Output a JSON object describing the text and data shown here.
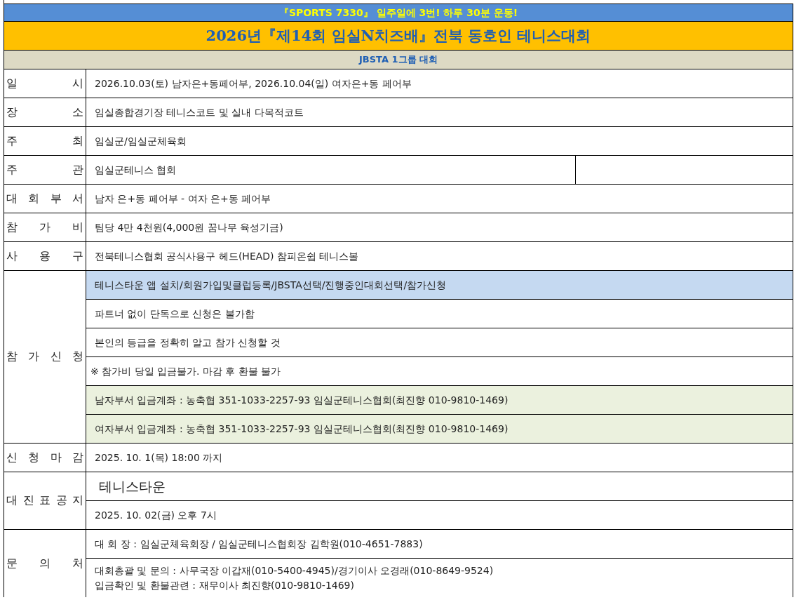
{
  "banner": "『SPORTS 7330』 일주일에 3번! 하루 30분 운동!",
  "title": "2026년『제14회 임실N치즈배』전북 동호인 테니스대회",
  "subtitle": "JBSTA 1그룹 대회",
  "rows": [
    {
      "label": "일 시",
      "split": false,
      "values": [
        {
          "kind": "text",
          "lines": [
            "2026.10.03(토) 남자은+동페어부, 2026.10.04(일) 여자은+동 페어부"
          ]
        }
      ]
    },
    {
      "label": "장 소",
      "split": false,
      "values": [
        {
          "kind": "text",
          "lines": [
            "임실종합경기장 테니스코트 및 실내 다목적코트"
          ]
        }
      ]
    },
    {
      "label": "주 최",
      "split": false,
      "values": [
        {
          "kind": "text",
          "lines": [
            "임실군/임실군체육회"
          ]
        }
      ]
    },
    {
      "label": "주 관",
      "split": true,
      "values": [
        {
          "kind": "text",
          "lines": [
            "임실군테니스 협회"
          ]
        }
      ]
    },
    {
      "label": "대 회 부 서",
      "split": false,
      "values": [
        {
          "kind": "text",
          "lines": [
            "남자 은+동 페어부 - 여자 은+동 페어부"
          ]
        }
      ]
    },
    {
      "label": "참 가 비",
      "split": false,
      "values": [
        {
          "kind": "text",
          "lines": [
            "팀당 4만 4천원(4,000원 꿈나무 육성기금)"
          ]
        }
      ]
    },
    {
      "label": "사 용 구",
      "split": false,
      "values": [
        {
          "kind": "text",
          "lines": [
            "전북테니스협회 공식사용구 헤드(HEAD) 참피온쉽 테니스볼"
          ]
        }
      ]
    },
    {
      "label": "참 가 신 청",
      "split": false,
      "values": [
        {
          "kind": "text",
          "color": "#c5d9f1",
          "lines": [
            "테니스타운 앱 설치/회원가입및클럽등록/JBSTA선택/진행중인대회선택/참가신청"
          ]
        },
        {
          "kind": "text",
          "lines": [
            "파트너 없이 단독으로 신청은 불가함"
          ]
        },
        {
          "kind": "text",
          "lines": [
            "본인의 등급을 정확히 알고 참가 신청할 것"
          ]
        },
        {
          "kind": "note",
          "lines": [
            "※ 참가비 당일 입금불가. 마감 후 환불 불가"
          ]
        },
        {
          "kind": "text",
          "color": "#ebf1de",
          "lines": [
            "남자부서 입금계좌 : 농축협 351-1033-2257-93 임실군테니스협회(최진향 010-9810-1469)"
          ]
        },
        {
          "kind": "text",
          "color": "#ebf1de",
          "lines": [
            "여자부서 입금계좌 : 농축협 351-1033-2257-93 임실군테니스협회(최진향 010-9810-1469)"
          ]
        }
      ]
    },
    {
      "label": "신 청 마 감",
      "split": false,
      "values": [
        {
          "kind": "text",
          "lines": [
            "2025. 10. 1(목) 18:00 까지"
          ]
        }
      ]
    },
    {
      "label": "대 진 표 공 지",
      "split": false,
      "values": [
        {
          "kind": "heading",
          "lines": [
            "테니스타운"
          ]
        },
        {
          "kind": "text",
          "lines": [
            "2025. 10. 02(금) 오후 7시"
          ]
        }
      ]
    },
    {
      "label": "문 의 처",
      "split": false,
      "values": [
        {
          "kind": "text",
          "lines": [
            "대 회 장 : 임실군체육회장 / 임실군테니스협회장 김학원(010-4651-7883)"
          ]
        },
        {
          "kind": "text",
          "lines": [
            "대회총괄 및 문의 : 사무국장 이갑재(010-5400-4945)/경기이사 오경래(010-8649-9524)",
            "입금확인 및 환불관련 : 재무이사 최진향(010-9810-1469)"
          ]
        }
      ]
    }
  ]
}
